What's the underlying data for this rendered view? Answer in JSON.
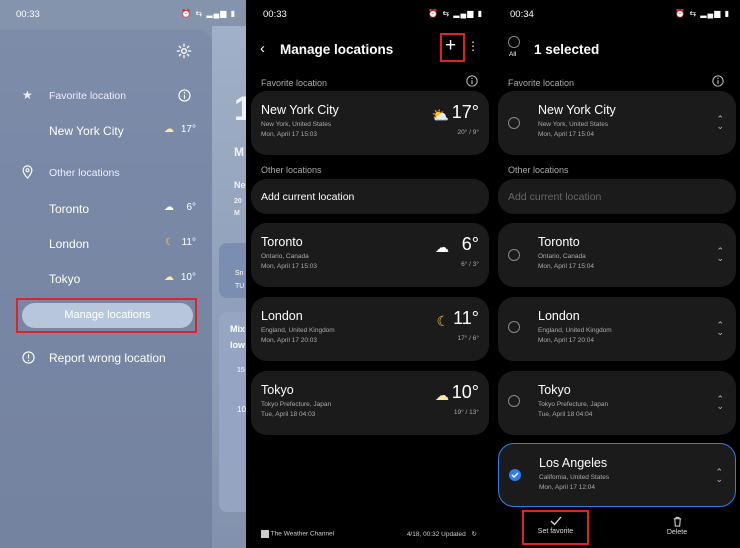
{
  "panel1": {
    "status": {
      "time": "00:33",
      "icons": "⏰ ⇆ ▂▄▆ ▮"
    },
    "settings_icon": "gear-icon",
    "favorite_heading": "Favorite location",
    "favorite_city": {
      "name": "New York City",
      "temp": "17°",
      "icon": "☁"
    },
    "other_heading": "Other locations",
    "others": [
      {
        "name": "Toronto",
        "temp": "6°",
        "icon": "☁"
      },
      {
        "name": "London",
        "temp": "11°",
        "icon": "☾"
      },
      {
        "name": "Tokyo",
        "temp": "10°",
        "icon": "☁"
      }
    ],
    "manage_button": "Manage locations",
    "report": "Report wrong location",
    "bg": {
      "t1": "1",
      "t2": "M",
      "t3": "Ne",
      "t4": "20",
      "t5": "M",
      "c1": "Sn",
      "c2": "TU",
      "c3": "Mix",
      "c4": "low",
      "c5": "15",
      "c6": "10"
    }
  },
  "panel2": {
    "status": {
      "time": "00:33",
      "icons": "⏰ ⇆ ▂▄▆ ▮"
    },
    "title": "Manage locations",
    "favorite_heading": "Favorite location",
    "favorite": {
      "city": "New York City",
      "region": "New York, United States",
      "date": "Mon, April 17 15:03",
      "temp": "17°",
      "hilo": "20° / 9°",
      "icon": "⛅"
    },
    "other_heading": "Other locations",
    "add_current": "Add current location",
    "cities": [
      {
        "city": "Toronto",
        "region": "Ontario, Canada",
        "date": "Mon, April 17 15:03",
        "temp": "6°",
        "hilo": "6° / 3°",
        "icon": "☁"
      },
      {
        "city": "London",
        "region": "England, United Kingdom",
        "date": "Mon, April 17 20:03",
        "temp": "11°",
        "hilo": "17° / 6°",
        "icon": "☾"
      },
      {
        "city": "Tokyo",
        "region": "Tokyo Prefecture, Japan",
        "date": "Tue, April 18 04:03",
        "temp": "10°",
        "hilo": "19° / 13°",
        "icon": "☁"
      }
    ],
    "footer_brand": "The Weather Channel",
    "footer_updated": "4/18, 00:32 Updated"
  },
  "panel3": {
    "status": {
      "time": "00:34",
      "icons": "⏰ ⇆ ▂▄▆ ▮"
    },
    "all_label": "All",
    "title": "1 selected",
    "favorite_heading": "Favorite location",
    "favorite": {
      "city": "New York City",
      "region": "New York, United States",
      "date": "Mon, April 17 15:04"
    },
    "other_heading": "Other locations",
    "add_current": "Add current location",
    "cities": [
      {
        "city": "Toronto",
        "region": "Ontario, Canada",
        "date": "Mon, April 17 15:04"
      },
      {
        "city": "London",
        "region": "England, United Kingdom",
        "date": "Mon, April 17 20:04"
      },
      {
        "city": "Tokyo",
        "region": "Tokyo Prefecture, Japan",
        "date": "Tue, April 18 04:04"
      },
      {
        "city": "Los Angeles",
        "region": "California, United States",
        "date": "Mon, April 17 12:04"
      }
    ],
    "set_favorite": "Set favorite",
    "delete": "Delete"
  },
  "colors": {
    "accent_blue": "#2d7ff0",
    "highlight_red": "#e0202a",
    "card_bg": "#1b1b1b"
  }
}
